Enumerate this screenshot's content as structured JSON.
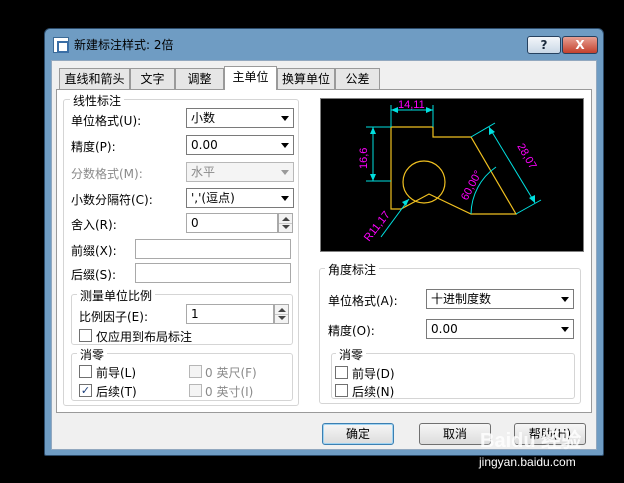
{
  "window": {
    "title": "新建标注样式: 2倍",
    "help_glyph": "?",
    "close_glyph": "X"
  },
  "tabs": [
    {
      "label": "直线和箭头"
    },
    {
      "label": "文字"
    },
    {
      "label": "调整"
    },
    {
      "label": "主单位",
      "active": true
    },
    {
      "label": "换算单位"
    },
    {
      "label": "公差"
    }
  ],
  "linear": {
    "group_label": "线性标注",
    "unit_format_label": "单位格式(U):",
    "unit_format_value": "小数",
    "precision_label": "精度(P):",
    "precision_value": "0.00",
    "fraction_format_label": "分数格式(M):",
    "fraction_format_value": "水平",
    "decimal_separator_label": "小数分隔符(C):",
    "decimal_separator_value": "','(逗点)",
    "round_off_label": "舍入(R):",
    "round_off_value": "0",
    "prefix_label": "前缀(X):",
    "prefix_value": "",
    "suffix_label": "后缀(S):",
    "suffix_value": ""
  },
  "scale": {
    "group_label": "测量单位比例",
    "factor_label": "比例因子(E):",
    "factor_value": "1",
    "layout_only_label": "仅应用到布局标注",
    "layout_only_checked": false
  },
  "zero_linear": {
    "group_label": "消零",
    "leading_label": "前导(L)",
    "leading_checked": false,
    "trailing_label": "后续(T)",
    "trailing_checked": true,
    "feet_label": "0 英尺(F)",
    "inches_label": "0 英寸(I)",
    "check_mark": "✓"
  },
  "preview": {
    "dim_top": "14,11",
    "dim_left": "16,6",
    "dim_right": "28,07",
    "dim_angle": "60,00°",
    "dim_radius": "R11,17",
    "colors": {
      "dims": "#00e0e0",
      "text": "#ff00ff",
      "shape": "#f0c020",
      "background": "#000000"
    }
  },
  "angular": {
    "group_label": "角度标注",
    "unit_format_label": "单位格式(A):",
    "unit_format_value": "十进制度数",
    "precision_label": "精度(O):",
    "precision_value": "0.00"
  },
  "zero_angular": {
    "group_label": "消零",
    "leading_label": "前导(D)",
    "leading_checked": false,
    "trailing_label": "后续(N)",
    "trailing_checked": false
  },
  "buttons": {
    "ok": "确定",
    "cancel": "取消",
    "help": "帮助(H)"
  },
  "watermark": {
    "brand": "Baidu 经验",
    "url": "jingyan.baidu.com"
  }
}
